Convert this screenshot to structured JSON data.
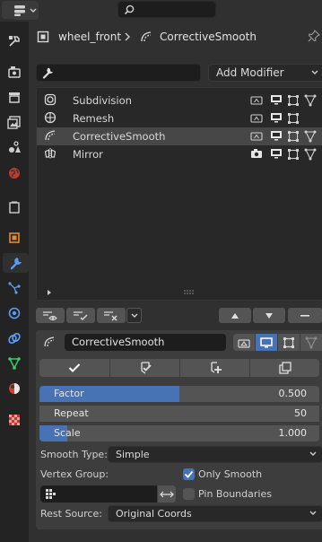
{
  "breadcrumb": {
    "object": "wheel_front",
    "modifier": "CorrectiveSmooth"
  },
  "toolbar": {
    "add_modifier_label": "Add Modifier"
  },
  "modifier_stack": [
    {
      "name": "Subdivision",
      "icon": "subdivision-icon",
      "selected": false
    },
    {
      "name": "Remesh",
      "icon": "remesh-icon",
      "selected": false
    },
    {
      "name": "CorrectiveSmooth",
      "icon": "smooth-icon",
      "selected": true
    },
    {
      "name": "Mirror",
      "icon": "mirror-icon",
      "selected": false
    }
  ],
  "panel": {
    "modifier_name": "CorrectiveSmooth",
    "factor_label": "Factor",
    "factor_value": "0.500",
    "factor_fraction": 0.5,
    "repeat_label": "Repeat",
    "repeat_value": "50",
    "scale_label": "Scale",
    "scale_value": "1.000",
    "scale_fraction": 0.1,
    "smooth_type_label": "Smooth Type:",
    "smooth_type_value": "Simple",
    "vertex_group_label": "Vertex Group:",
    "only_smooth_label": "Only Smooth",
    "only_smooth_checked": true,
    "pin_boundaries_label": "Pin Boundaries",
    "pin_boundaries_checked": false,
    "rest_source_label": "Rest Source:",
    "rest_source_value": "Original Coords"
  },
  "colors": {
    "accent": "#4772b3",
    "tabbar": "#232323",
    "panel": "#3d3d3d"
  }
}
